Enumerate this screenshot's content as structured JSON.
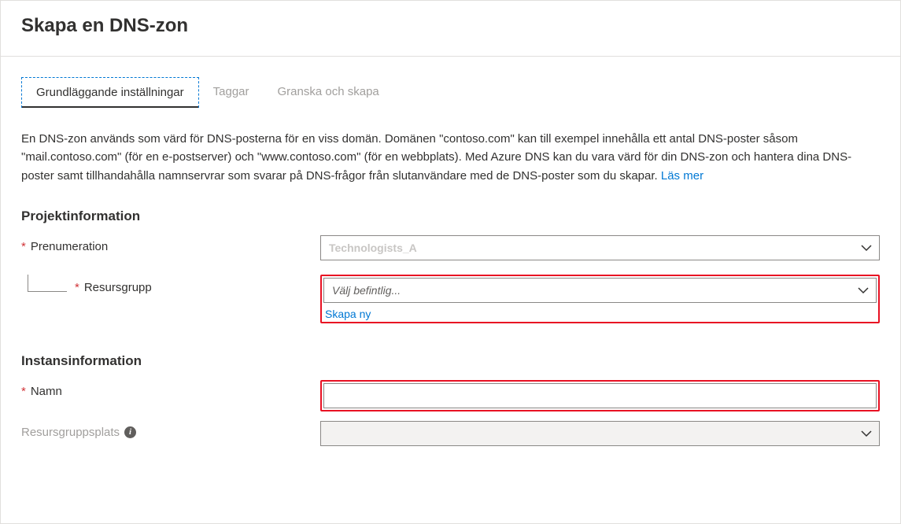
{
  "header": {
    "title": "Skapa en DNS-zon"
  },
  "tabs": [
    {
      "label": "Grundläggande inställningar",
      "active": true
    },
    {
      "label": "Taggar",
      "active": false
    },
    {
      "label": "Granska och skapa",
      "active": false
    }
  ],
  "description": {
    "text": "En DNS-zon används som värd för DNS-posterna för en viss domän. Domänen \"contoso.com\" kan till exempel innehålla ett antal DNS-poster såsom \"mail.contoso.com\" (för en e-postserver) och \"www.contoso.com\" (för en webbplats). Med Azure DNS kan du vara värd för din DNS-zon och hantera dina DNS-poster samt tillhandahålla namnservrar som svarar på DNS-frågor från slutanvändare med de DNS-poster som du skapar. ",
    "link": "Läs mer"
  },
  "sections": {
    "project": {
      "heading": "Projektinformation",
      "subscription": {
        "label": "Prenumeration",
        "value": "Technologists_A"
      },
      "resourceGroup": {
        "label": "Resursgrupp",
        "placeholder": "Välj befintlig...",
        "createNew": "Skapa ny"
      }
    },
    "instance": {
      "heading": "Instansinformation",
      "name": {
        "label": "Namn",
        "value": ""
      },
      "location": {
        "label": "Resursgruppsplats",
        "value": ""
      }
    }
  }
}
